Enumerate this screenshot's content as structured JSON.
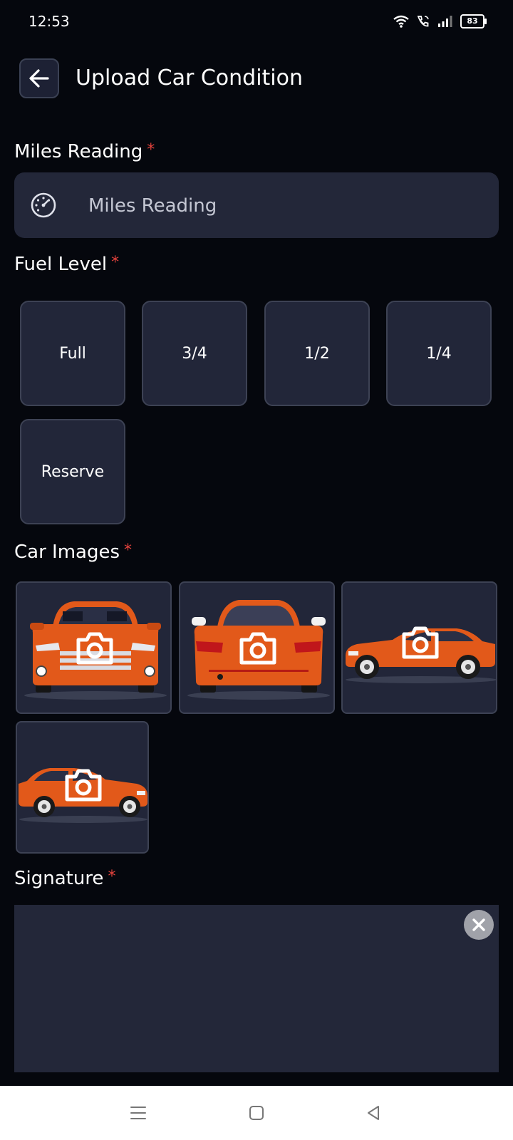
{
  "status": {
    "time": "12:53",
    "battery": "83"
  },
  "header": {
    "title": "Upload Car Condition"
  },
  "miles": {
    "label": "Miles Reading",
    "required_mark": "*",
    "placeholder": "Miles Reading",
    "value": ""
  },
  "fuel": {
    "label": "Fuel Level",
    "required_mark": "*",
    "options": [
      "Full",
      "3/4",
      "1/2",
      "1/4",
      "Reserve"
    ]
  },
  "car_images": {
    "label": "Car Images",
    "required_mark": "*",
    "views": [
      "front",
      "rear",
      "right-side",
      "left-side"
    ]
  },
  "signature": {
    "label": "Signature",
    "required_mark": "*"
  },
  "colors": {
    "background": "#05070d",
    "surface": "#232739",
    "accent_required": "#e5433d",
    "car": "#e2591a"
  }
}
